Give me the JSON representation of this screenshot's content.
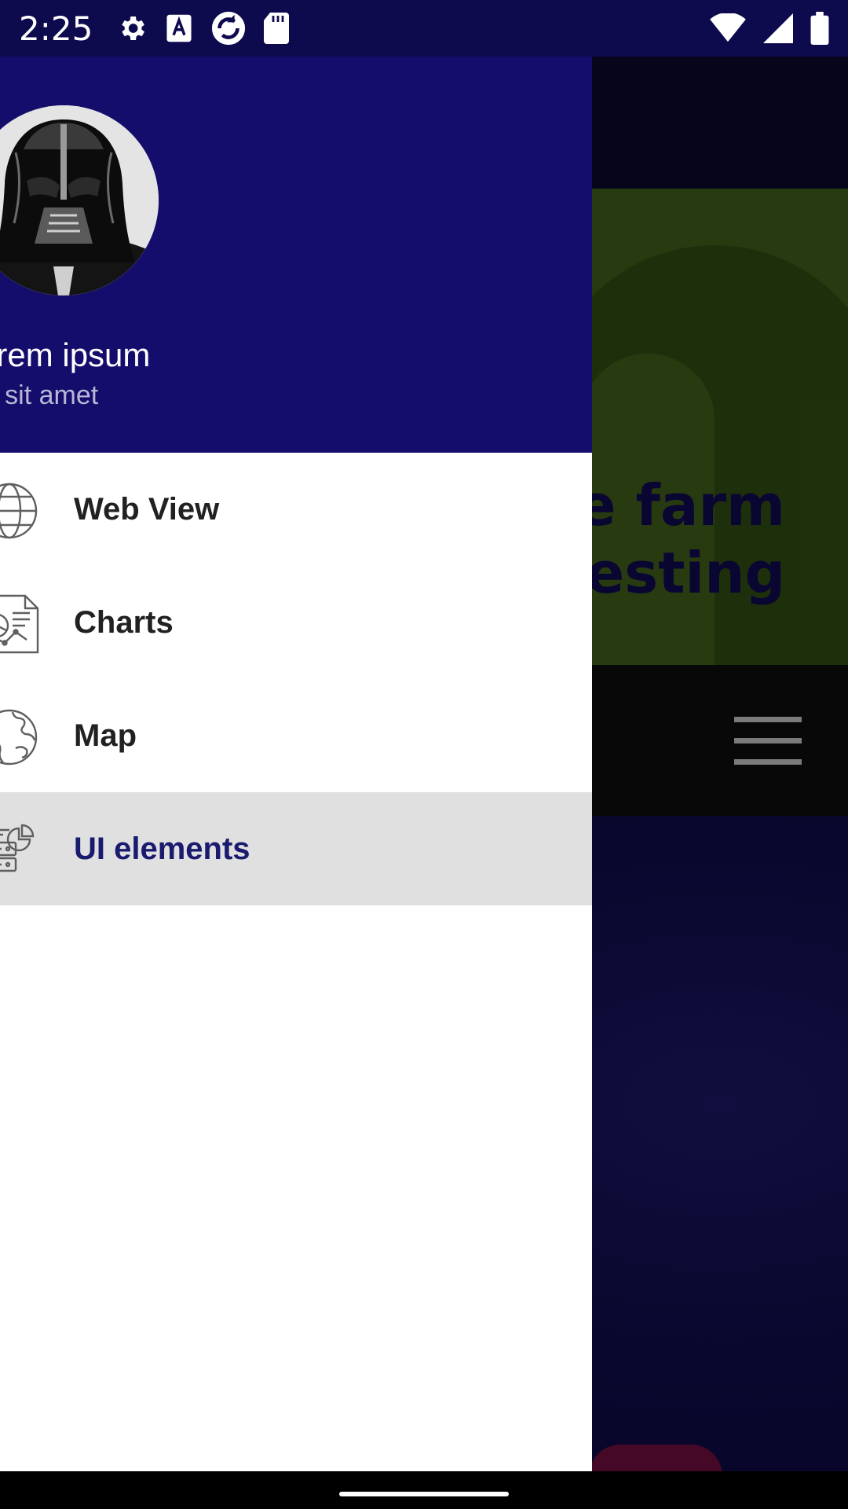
{
  "status_bar": {
    "time": "2:25",
    "left_icons": [
      "settings-icon",
      "font-a-icon",
      "sync-app-icon",
      "sd-card-icon"
    ],
    "right_icons": [
      "wifi-icon",
      "signal-icon",
      "battery-icon"
    ]
  },
  "drawer": {
    "header": {
      "name": "orem ipsum",
      "subtitle": "olor sit amet",
      "avatar": "darth-vader-avatar"
    },
    "items": [
      {
        "label": "Web View",
        "icon": "globe-icon",
        "active": false
      },
      {
        "label": "Charts",
        "icon": "chart-document-icon",
        "active": false
      },
      {
        "label": "Map",
        "icon": "earth-icon",
        "active": false
      },
      {
        "label": "UI elements",
        "icon": "ui-elements-icon",
        "active": true
      }
    ]
  },
  "background": {
    "hero_text_line1": "e farm",
    "hero_text_line2": "testing",
    "menu_icon": "hamburger-menu-icon"
  },
  "colors": {
    "status_bar": "#0e0a4e",
    "drawer_header": "#140d6c",
    "active_item_bg": "#e0e0e0",
    "active_item_text": "#1a1a6e",
    "hero_green": "#3e5a1a"
  }
}
